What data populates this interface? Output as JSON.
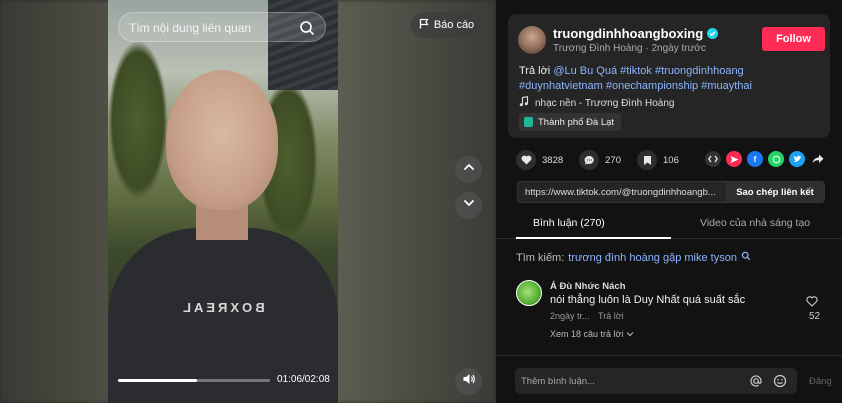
{
  "video": {
    "search_placeholder": "Tìm nội dung liên quan",
    "report_label": "Báo cáo",
    "time_display": "01:06/02:08",
    "progress_fraction": 0.52,
    "shirt_text": "BOXREAL"
  },
  "author": {
    "username": "truongdinhhoangboxing",
    "display_name": "Trương Đình Hoàng",
    "separator": " · ",
    "posted": "2ngày trước",
    "follow_label": "Follow"
  },
  "caption": {
    "prefix": "Trả lời ",
    "mention": "@Lu Bu Quá",
    "hashtags_line1": " #tiktok #truongdinhhoang",
    "hashtags_line2": "#duynhatvietnam #onechampionship #muaythai"
  },
  "music": {
    "label": "nhạc nền - Trương Đình Hoàng"
  },
  "location": {
    "label": "Thành phố Đà Lạt"
  },
  "stats": {
    "likes": "3828",
    "comments": "270",
    "saves": "106"
  },
  "share": {
    "link": "https://www.tiktok.com/@truongdinhhoangb...",
    "copy_label": "Sao chép liên kết"
  },
  "tabs": {
    "comments_label": "Bình luận (270)",
    "creator_videos_label": "Video của nhà sáng tạo"
  },
  "search_suggestion": {
    "prefix": "Tìm kiếm: ",
    "query": "trương đình hoàng gặp mike tyson"
  },
  "comments": [
    {
      "author": "Á Đù Nhức Nách",
      "text": "nói thẳng luôn là Duy Nhất quá suất sắc",
      "time": "2ngày tr...",
      "reply_label": "Trả lời",
      "view_replies": "Xem 18 câu trả lời",
      "likes": "52"
    }
  ],
  "comment_box": {
    "placeholder": "Thêm bình luận...",
    "post_label": "Đăng"
  },
  "colors": {
    "accent": "#fe2c55",
    "link": "#8cb4ff",
    "verified": "#20d5ec"
  }
}
